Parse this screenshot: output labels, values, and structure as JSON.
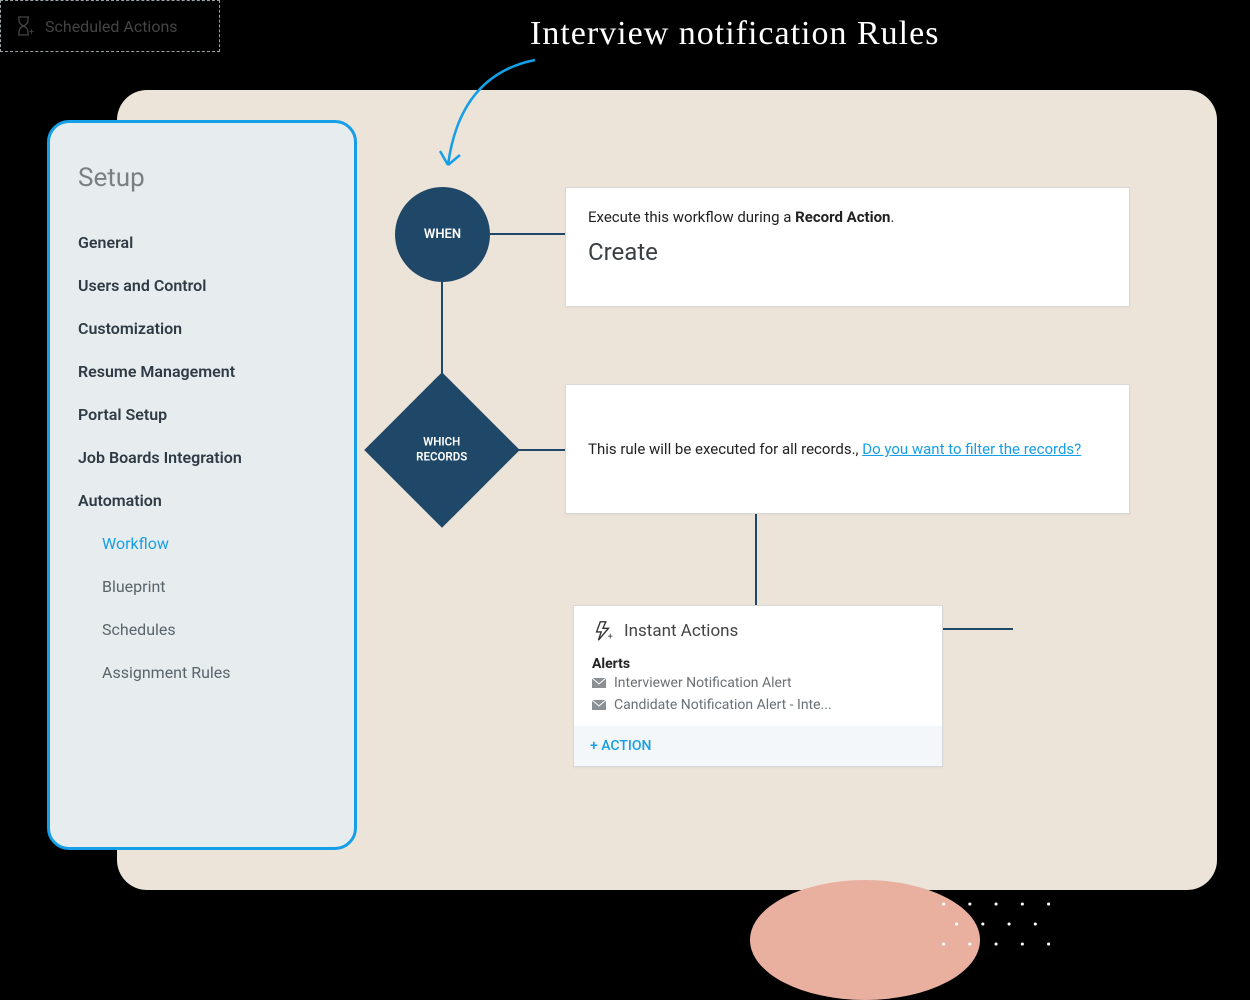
{
  "annotation": "Interview notification Rules",
  "sidebar": {
    "title": "Setup",
    "items": [
      {
        "label": "General"
      },
      {
        "label": "Users and Control"
      },
      {
        "label": "Customization"
      },
      {
        "label": "Resume Management"
      },
      {
        "label": "Portal Setup"
      },
      {
        "label": "Job Boards Integration"
      },
      {
        "label": "Automation"
      }
    ],
    "subitems": [
      {
        "label": "Workflow",
        "active": true
      },
      {
        "label": "Blueprint"
      },
      {
        "label": "Schedules"
      },
      {
        "label": "Assignment Rules"
      }
    ]
  },
  "flow": {
    "when_label": "WHEN",
    "when_card": {
      "text_prefix": "Execute this workflow during a ",
      "text_bold": "Record Action",
      "text_suffix": ".",
      "value": "Create"
    },
    "which_label_line1": "WHICH",
    "which_label_line2": "RECORDS",
    "which_card": {
      "text": "This rule will be executed for all records., ",
      "link": "Do you want to filter the records?"
    },
    "instant": {
      "title": "Instant Actions",
      "alerts_label": "Alerts",
      "alerts": [
        "Interviewer Notification Alert",
        "Candidate Notification Alert - Inte..."
      ],
      "add_action": "+ ACTION"
    },
    "scheduled_title": "Scheduled Actions"
  }
}
